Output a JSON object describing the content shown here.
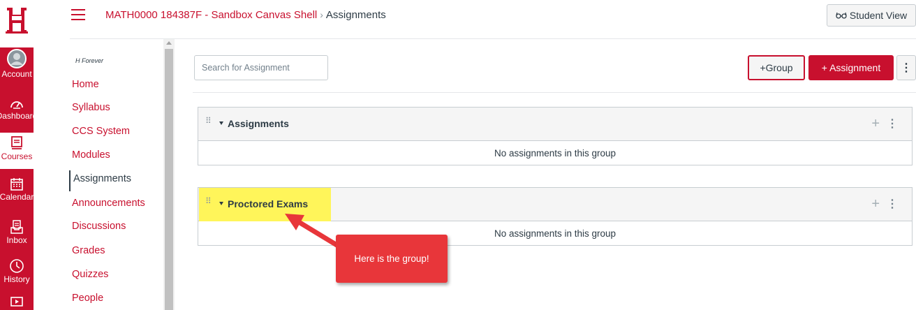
{
  "global_nav": {
    "logo_text": "UH",
    "items": [
      {
        "label": "Account",
        "icon": "account-avatar-icon"
      },
      {
        "label": "Dashboard",
        "icon": "dashboard-icon"
      },
      {
        "label": "Courses",
        "icon": "courses-icon"
      },
      {
        "label": "Calendar",
        "icon": "calendar-icon"
      },
      {
        "label": "Inbox",
        "icon": "inbox-icon"
      },
      {
        "label": "History",
        "icon": "history-icon"
      },
      {
        "label": "",
        "icon": "commons-icon"
      }
    ]
  },
  "header": {
    "course": "MATH0000 184387F - Sandbox Canvas Shell",
    "separator": "›",
    "current": "Assignments",
    "student_view": "Student View"
  },
  "course_nav": {
    "subtitle": "H Forever",
    "items": [
      {
        "label": "Home"
      },
      {
        "label": "Syllabus"
      },
      {
        "label": "CCS System"
      },
      {
        "label": "Modules"
      },
      {
        "label": "Assignments",
        "active": true
      },
      {
        "label": "Announcements"
      },
      {
        "label": "Discussions"
      },
      {
        "label": "Grades"
      },
      {
        "label": "Quizzes"
      },
      {
        "label": "People"
      }
    ]
  },
  "main": {
    "search_placeholder": "Search for Assignment",
    "group_button": "+Group",
    "assignment_button": "+ Assignment",
    "groups": [
      {
        "name": "Assignments",
        "empty_text": "No assignments in this group"
      },
      {
        "name": "Proctored Exams",
        "empty_text": "No assignments in this group"
      }
    ]
  },
  "annotation": {
    "callout_text": "Here is the group!"
  },
  "colors": {
    "brand": "#c8102e",
    "highlight": "#fff55a",
    "callout": "#e8363a"
  }
}
